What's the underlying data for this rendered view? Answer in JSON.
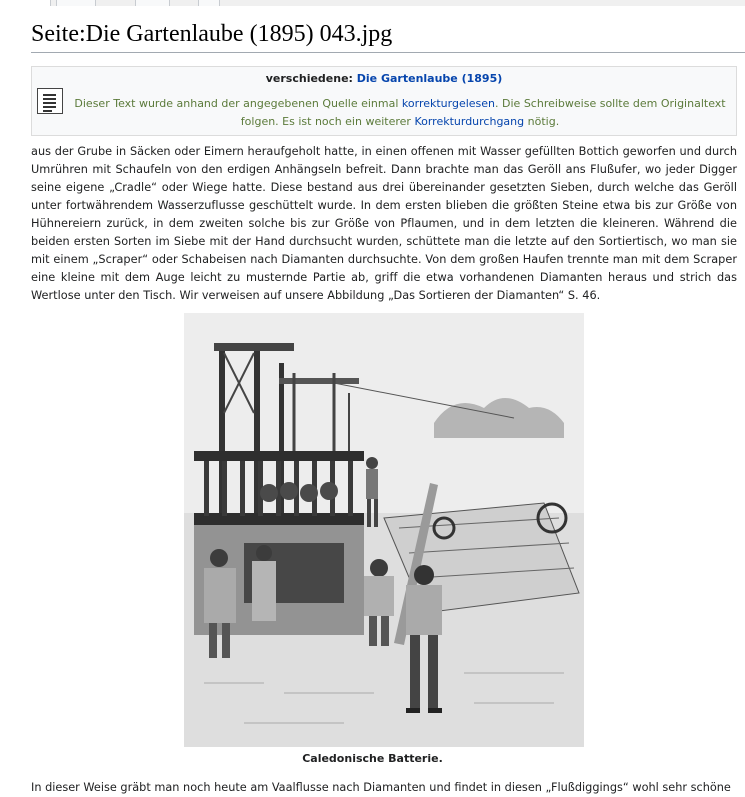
{
  "page": {
    "title": "Seite:Die Gartenlaube (1895) 043.jpg"
  },
  "notice": {
    "heading_prefix": "verschiedene: ",
    "heading_link": "Die Gartenlaube (1895)",
    "body_part1": "Dieser Text wurde anhand der angegebenen Quelle einmal ",
    "body_link1": "korrekturgelesen",
    "body_part2": ". Die Schreibweise sollte dem Originaltext folgen. Es ist noch ein weiterer ",
    "body_link2": "Korrekturdurchgang",
    "body_part3": " nötig."
  },
  "content": {
    "paragraph": "aus der Grube in Säcken oder Eimern heraufgeholt hatte, in einen offenen mit Wasser gefüllten Bottich geworfen und durch Umrühren mit Schaufeln von den erdigen Anhängseln befreit. Dann brachte man das Geröll ans Flußufer, wo jeder Digger seine eigene „Cradle“ oder Wiege hatte. Diese bestand aus drei übereinander gesetzten Sieben, durch welche das Geröll unter fortwährendem Wasserzuflusse geschüttelt wurde. In dem ersten blieben die größten Steine etwa bis zur Größe von Hühnereiern zurück, in dem zweiten solche bis zur Größe von Pflaumen, und in dem letzten die kleineren. Während die beiden ersten Sorten im Siebe mit der Hand durchsucht wurden, schüttete man die letzte auf den Sortiertisch, wo man sie mit einem „Scraper“ oder Schabeisen nach Diamanten durchsuchte. Von dem großen Haufen trennte man mit dem Scraper eine kleine mit dem Auge leicht zu musternde Partie ab, griff die etwa vorhandenen Diamanten heraus und strich das Wertlose unter den Tisch. Wir verweisen auf unsere Abbildung „Das Sortieren der Diamanten“ S. 46.",
    "figure_caption": "Caledonische Batterie.",
    "paragraph2": "In dieser Weise gräbt man noch heute am Vaalflusse nach Diamanten und findet in diesen „Flußdiggings“ wohl sehr schöne"
  }
}
